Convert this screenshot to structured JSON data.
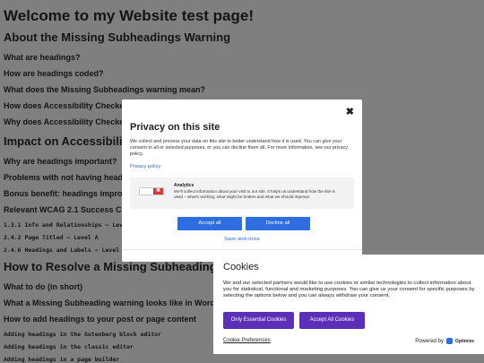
{
  "page": {
    "title": "Welcome to my Website test page!",
    "headings": [
      {
        "level": "h2",
        "text": "About the Missing Subheadings Warning"
      },
      {
        "level": "h3",
        "text": "What are headings?"
      },
      {
        "level": "h3",
        "text": "How are headings coded?"
      },
      {
        "level": "h3",
        "text": "What does the Missing Subheadings warning mean?"
      },
      {
        "level": "h3",
        "text": "How does Accessibility Checker test for headings in content?"
      },
      {
        "level": "h3",
        "text": "Why does Accessibility Checker flag this warning?"
      },
      {
        "level": "h2",
        "text": "Impact on Accessibility"
      },
      {
        "level": "h3",
        "text": "Why are headings important?"
      },
      {
        "level": "h3",
        "text": "Problems with not having headings"
      },
      {
        "level": "h3",
        "text": "Bonus benefit: headings improve SEO"
      },
      {
        "level": "h3",
        "text": "Relevant WCAG 2.1 Success Criteria"
      },
      {
        "level": "h4",
        "text": "1.3.1 Info and Relationships – Level A"
      },
      {
        "level": "h4",
        "text": "2.4.2 Page Titled – Level A"
      },
      {
        "level": "h4",
        "text": "2.4.6 Headings and Labels – Level AA"
      },
      {
        "level": "h2",
        "text": "How to Resolve a Missing Subheadings Warning"
      },
      {
        "level": "h3",
        "text": "What to do (in short)"
      },
      {
        "level": "h3",
        "text": "What a Missing Subheading warning looks like in WordPress"
      },
      {
        "level": "h3",
        "text": "How to add headings to your post or page content"
      },
      {
        "level": "h4",
        "text": "Adding headings in the Gutenberg block editor"
      },
      {
        "level": "h4",
        "text": "Adding headings in the classic editor"
      },
      {
        "level": "h4",
        "text": "Adding headings in a page builder"
      }
    ]
  },
  "privacy_modal": {
    "close_glyph": "✖",
    "title": "Privacy on this site",
    "description": "We collect and process your data on this site to better understand how it is used. You can give your consent to all or selected purposes, or you can decline them all. For more information, see our privacy policy.",
    "policy_link": "Privacy policy",
    "purpose": {
      "toggle_glyph": "✖",
      "title": "Analytics",
      "text": "We'll collect information about your visit to our site. It helps us understand how the site is used – what's working, what might be broken and what we should improve."
    },
    "accept_label": "Accept all",
    "decline_label": "Decline all",
    "save_label": "Save and close"
  },
  "cookie_banner": {
    "title": "Cookies",
    "description": "We and our selected partners would like to use cookies or similar technologies to collect information about you for statistical, functional and marketing purposes. You can give us your consent for specific purposes by selecting the options below and you can always withdraw your consent.",
    "essential_label": "Only Essential Cookies",
    "accept_all_label": "Accept All Cookies",
    "preferences_label": "Cookie Preferences",
    "powered_label": "Powered by",
    "brand": "Optimize"
  },
  "colors": {
    "overlay_bg": "#7f7f7f",
    "primary_blue": "#2f6ee0",
    "cookie_purple": "#5b2fb8",
    "toggle_red": "#d93a3a"
  }
}
